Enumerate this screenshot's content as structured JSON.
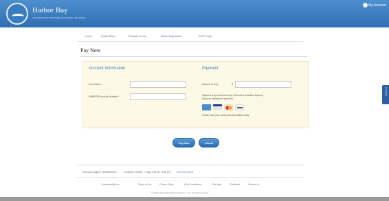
{
  "header": {
    "brand": "Harbor Bay",
    "tagline": "A DIVISION OF MARITIME & COASTAL SERVICES",
    "account_label": "My Account"
  },
  "nav": {
    "items": [
      "Home",
      "Retail Offices",
      "Printable Forms",
      "Vessel Registration",
      "ESCP Login"
    ]
  },
  "page": {
    "title": "Pay Now"
  },
  "account": {
    "heading": "Account Information",
    "name_label": "Your Name *",
    "name_value": "",
    "number_label": "HARBOR Account Number *",
    "number_value": ""
  },
  "payment": {
    "heading": "Payment",
    "amount_label": "Amount to Pay *",
    "currency": "$",
    "amount_value": "",
    "note_line1": "Payment is by credit card only. We accept American Express,",
    "note_line2": "Discover, Mastercard and Visa.",
    "note_line3": "Please have your credit card information ready.",
    "cards": [
      "amex-card-icon",
      "visa-card-icon",
      "mastercard-card-icon",
      "discover-card-icon"
    ]
  },
  "actions": {
    "pay_label": "Pay Now",
    "cancel_label": "Cancel"
  },
  "side_tab": {
    "label": "Feedback"
  },
  "footer": {
    "support": "Technical Support · 800.555.0123",
    "hours": "Customer Service · 7 days 7:30 am - 8:30 pm",
    "live_chat": "Live Chat Online",
    "links": [
      "Sustainability Info",
      "Terms of Use",
      "Privacy Policy",
      "ADA Compliance",
      "Site Map",
      "Feedback",
      "Contact Us"
    ],
    "copyright": "© 2015 Harbor Bay Maritime Services, LLC. All rights reserved."
  },
  "colors": {
    "header_blue": "#2f6fb2",
    "accent_blue": "#3d80c4",
    "panel_bg": "#fdf9e6",
    "button_blue": "#2e6db0"
  }
}
